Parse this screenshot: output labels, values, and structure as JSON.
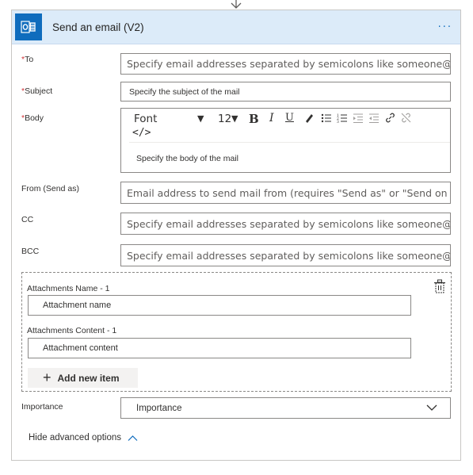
{
  "header": {
    "title": "Send an email (V2)",
    "more": "···",
    "accent": "#0f6cbd",
    "background": "#dcebf9"
  },
  "fields": {
    "to": {
      "label": "To",
      "placeholder": "Specify email addresses separated by semicolons like someone@con"
    },
    "subject": {
      "label": "Subject",
      "placeholder": "Specify the subject of the mail"
    },
    "body": {
      "label": "Body",
      "font": "Font",
      "size": "12",
      "placeholder": "Specify the body of the mail"
    },
    "from": {
      "label": "From (Send as)",
      "placeholder": "Email address to send mail from (requires \"Send as\" or \"Send on beh"
    },
    "cc": {
      "label": "CC",
      "placeholder": "Specify email addresses separated by semicolons like someone@con"
    },
    "bcc": {
      "label": "BCC",
      "placeholder": "Specify email addresses separated by semicolons like someone@con"
    }
  },
  "attachments": {
    "name_label": "Attachments Name - 1",
    "name_placeholder": "Attachment name",
    "content_label": "Attachments Content - 1",
    "content_placeholder": "Attachment content",
    "add_label": "Add new item"
  },
  "importance": {
    "label": "Importance",
    "value": "Importance"
  },
  "hide_advanced": "Hide advanced options",
  "required_mark": "*"
}
